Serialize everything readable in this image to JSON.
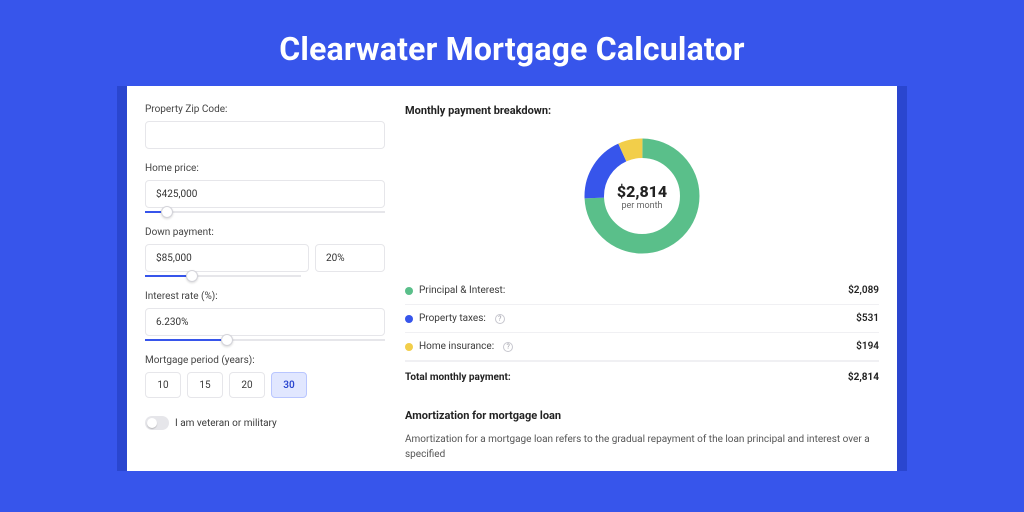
{
  "title": "Clearwater Mortgage Calculator",
  "left": {
    "zip_label": "Property Zip Code:",
    "zip_value": "",
    "price_label": "Home price:",
    "price_value": "$425,000",
    "price_slider_pct": 9,
    "down_label": "Down payment:",
    "down_value": "$85,000",
    "down_pct_value": "20%",
    "down_slider_pct": 30,
    "rate_label": "Interest rate (%):",
    "rate_value": "6.230%",
    "rate_slider_pct": 34,
    "period_label": "Mortgage period (years):",
    "periods": [
      "10",
      "15",
      "20",
      "30"
    ],
    "period_active_index": 3,
    "vet_label": "I am veteran or military"
  },
  "right": {
    "breakdown_heading": "Monthly payment breakdown:",
    "center_amount": "$2,814",
    "center_sub": "per month",
    "legend": [
      {
        "label": "Principal & Interest:",
        "value": "$2,089",
        "color": "#5abf8a",
        "help": false
      },
      {
        "label": "Property taxes:",
        "value": "$531",
        "color": "#3755eb",
        "help": true
      },
      {
        "label": "Home insurance:",
        "value": "$194",
        "color": "#f2ce4a",
        "help": true
      }
    ],
    "total_label": "Total monthly payment:",
    "total_value": "$2,814",
    "amort_heading": "Amortization for mortgage loan",
    "amort_text": "Amortization for a mortgage loan refers to the gradual repayment of the loan principal and interest over a specified"
  },
  "chart_data": {
    "type": "pie",
    "title": "Monthly payment breakdown",
    "categories": [
      "Principal & Interest",
      "Property taxes",
      "Home insurance"
    ],
    "values": [
      2089,
      531,
      194
    ],
    "colors": [
      "#5abf8a",
      "#3755eb",
      "#f2ce4a"
    ],
    "center_value": 2814,
    "center_label": "per month"
  }
}
